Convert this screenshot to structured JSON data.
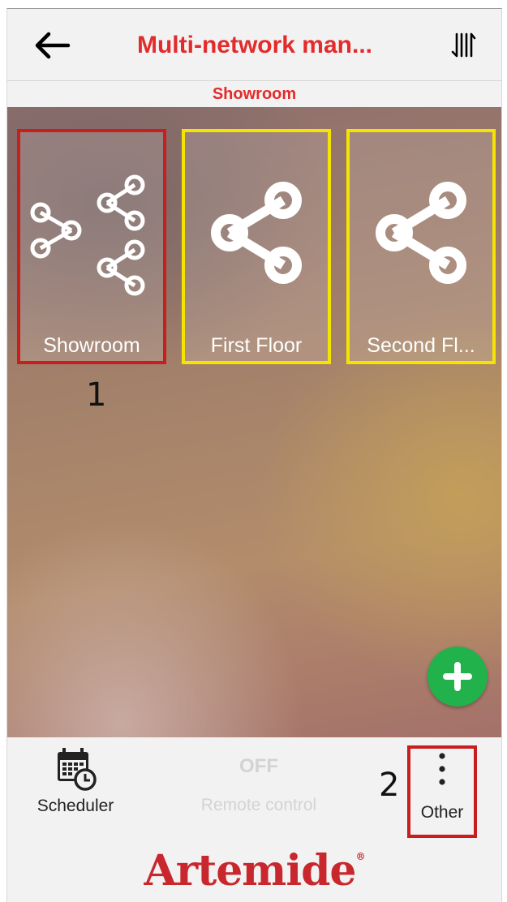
{
  "header": {
    "title": "Multi-network man...",
    "subtitle": "Showroom"
  },
  "icons": {
    "back": "arrow-left-icon",
    "sort": "sort-icon",
    "network": "share-network-icon",
    "add": "plus-icon",
    "scheduler": "calendar-clock-icon",
    "other": "more-vertical-icon"
  },
  "networks": [
    {
      "label": "Showroom",
      "type": "multi"
    },
    {
      "label": "First Floor",
      "type": "single"
    },
    {
      "label": "Second Fl...",
      "type": "single"
    }
  ],
  "annotations": {
    "one": "1",
    "two": "2"
  },
  "bottom": {
    "scheduler_label": "Scheduler",
    "remote_state": "OFF",
    "remote_label": "Remote control",
    "other_label": "Other"
  },
  "brand": {
    "name": "Artemide",
    "mark": "®"
  },
  "colors": {
    "accent": "#e32b2b",
    "fab": "#22b24c",
    "highlight_red": "#c81e1e",
    "highlight_yellow": "#f4e400"
  }
}
